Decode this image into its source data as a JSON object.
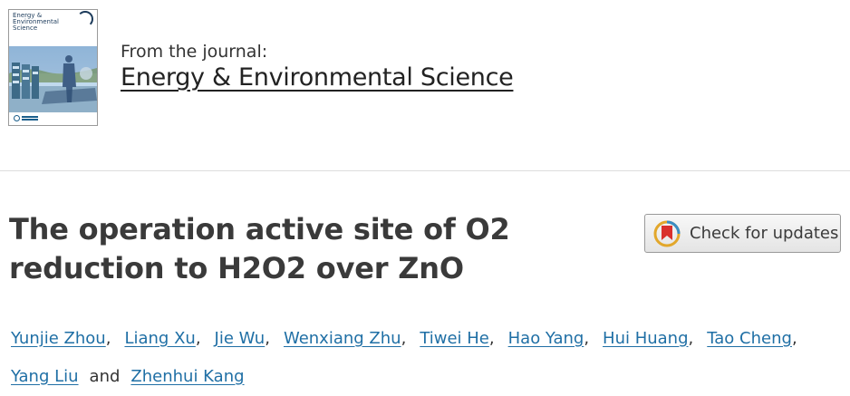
{
  "journal": {
    "from_label": "From the journal:",
    "name": "Energy & Environmental Science",
    "cover_title": "Energy &\nEnvironmental\nScience"
  },
  "article": {
    "title_line1": "The operation active site of O2",
    "title_line2": "reduction to H2O2 over ZnO"
  },
  "check_updates": {
    "label": "Check for updates",
    "icon": "crossmark-icon"
  },
  "authors": {
    "list": [
      "Yunjie Zhou",
      "Liang Xu",
      "Jie Wu",
      "Wenxiang Zhu",
      "Tiwei He",
      "Hao Yang",
      "Hui Huang",
      "Tao Cheng",
      "Yang Liu",
      "Zhenhui Kang"
    ],
    "separator": ",",
    "conjunction": "and"
  },
  "colors": {
    "link": "#1f6fa5",
    "title": "#3a3a3a",
    "divider": "#dddddd"
  }
}
